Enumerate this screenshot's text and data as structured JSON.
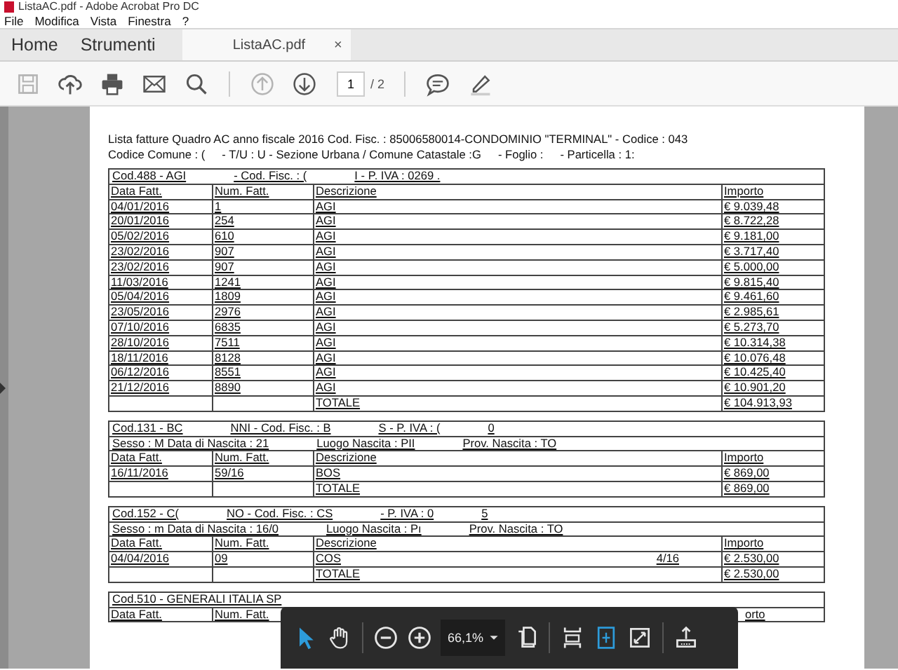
{
  "window": {
    "title": "ListaAC.pdf - Adobe Acrobat Pro DC"
  },
  "menu": [
    "File",
    "Modifica",
    "Vista",
    "Finestra",
    "?"
  ],
  "tabs": [
    {
      "label": "Home",
      "selected": false,
      "kind": "nav"
    },
    {
      "label": "Strumenti",
      "selected": false,
      "kind": "nav"
    },
    {
      "label": "ListaAC.pdf",
      "selected": true,
      "kind": "document",
      "close": "×"
    }
  ],
  "toolbar": {
    "tools": [
      {
        "kind": "save",
        "disabled": true
      },
      {
        "kind": "upload",
        "disabled": false
      },
      {
        "kind": "print",
        "disabled": false
      },
      {
        "kind": "mail",
        "disabled": false
      },
      {
        "kind": "search",
        "disabled": false
      },
      {
        "kind": "sep"
      },
      {
        "kind": "prev",
        "disabled": true
      },
      {
        "kind": "next",
        "disabled": false
      }
    ],
    "page": "1",
    "page_total": "/ 2",
    "right_tools": [
      {
        "kind": "comment",
        "disabled": false
      },
      {
        "kind": "highlight",
        "disabled": false
      }
    ]
  },
  "document": {
    "header_lines": [
      [
        "Lista fatture Quadro AC anno fiscale 2016 Cod. Fisc. : 85006580014-CONDOMINIO  \"TERMINAL\" - Codice : 043"
      ],
      [
        "Codice Comune : (",
        "- T/U : U - Sezione Urbana / Comune Catastale :G",
        "- Foglio :",
        "- Particella : 1:"
      ]
    ],
    "groups": [
      {
        "header": [
          [
            "Cod.488 - AGI",
            "- Cod. Fisc. : (",
            "I - P. IVA : 0269 ."
          ]
        ],
        "columns": [
          "Data Fatt.",
          "Num. Fatt.",
          "Descrizione",
          "Importo"
        ],
        "rows": [
          {
            "date": "04/01/2016",
            "number": "1",
            "description": "AGI",
            "amount": "€ 9.039,48"
          },
          {
            "date": "20/01/2016",
            "number": "254",
            "description": "AGI",
            "amount": "€ 8.722,28"
          },
          {
            "date": "05/02/2016",
            "number": "610",
            "description": "AGI",
            "amount": "€ 9.181,00"
          },
          {
            "date": "23/02/2016",
            "number": "907",
            "description": "AGI",
            "amount": "€ 3.717,40"
          },
          {
            "date": "23/02/2016",
            "number": "907",
            "description": "AGI",
            "amount": "€ 5.000,00"
          },
          {
            "date": "11/03/2016",
            "number": "1241",
            "description": "AGI",
            "amount": "€ 9.815,40"
          },
          {
            "date": "05/04/2016",
            "number": "1809",
            "description": "AGI",
            "amount": "€ 9.461,60"
          },
          {
            "date": "23/05/2016",
            "number": "2976",
            "description": "AGI",
            "amount": "€ 2.985,61"
          },
          {
            "date": "07/10/2016",
            "number": "6835",
            "description": "AGI",
            "amount": "€ 5.273,70"
          },
          {
            "date": "28/10/2016",
            "number": "7511",
            "description": "AGI",
            "amount": "€ 10.314,38"
          },
          {
            "date": "18/11/2016",
            "number": "8128",
            "description": "AGI",
            "amount": "€ 10.076,48"
          },
          {
            "date": "06/12/2016",
            "number": "8551",
            "description": "AGI",
            "amount": "€ 10.425,40"
          },
          {
            "date": "21/12/2016",
            "number": "8890",
            "description": "AGI",
            "amount": "€ 10.901,20"
          }
        ],
        "total": {
          "label": "TOTALE",
          "amount": "€ 104.913,93"
        }
      },
      {
        "header": [
          [
            "Cod.131 - BC",
            "NNI - Cod. Fisc. : B",
            "S - P. IVA : (",
            "0"
          ],
          [
            "Sesso : M Data di Nascita : 21",
            "Luogo Nascita : PII",
            "Prov. Nascita : TO"
          ]
        ],
        "columns": [
          "Data Fatt.",
          "Num. Fatt.",
          "Descrizione",
          "Importo"
        ],
        "rows": [
          {
            "date": "16/11/2016",
            "number": "59/16",
            "description": "BOS",
            "amount": "€ 869,00"
          }
        ],
        "total": {
          "label": "TOTALE",
          "amount": "€ 869,00"
        }
      },
      {
        "header": [
          [
            "Cod.152 - C(",
            "NO - Cod. Fisc. : CS",
            "- P. IVA : 0",
            "5"
          ],
          [
            "Sesso :  m Data di Nascita : 16/0",
            "Luogo Nascita : Pı",
            "Prov. Nascita : TO"
          ]
        ],
        "columns": [
          "Data Fatt.",
          "Num. Fatt.",
          "Descrizione",
          "Importo"
        ],
        "rows": [
          {
            "date": "04/04/2016",
            "number": "09",
            "description": "COS",
            "description_end": "4/16",
            "amount": "€ 2.530,00"
          }
        ],
        "total": {
          "label": "TOTALE",
          "amount": "€ 2.530,00"
        }
      },
      {
        "header": [
          [
            "Cod.510 - GENERALI ITALIA SP"
          ]
        ],
        "columns": [
          "Data Fatt.",
          "Num. Fatt."
        ],
        "column_4_partial": "orto"
      }
    ]
  },
  "floating_toolbar": {
    "tools": [
      {
        "kind": "select",
        "selected": true
      },
      {
        "kind": "hand",
        "selected": false
      }
    ],
    "zoom": "66,1%",
    "view_tools": [
      {
        "kind": "pages",
        "selected": false
      },
      {
        "kind": "scroll-mode",
        "selected": false
      },
      {
        "kind": "fit-page",
        "selected": true
      },
      {
        "kind": "full-screen",
        "selected": false
      }
    ]
  }
}
